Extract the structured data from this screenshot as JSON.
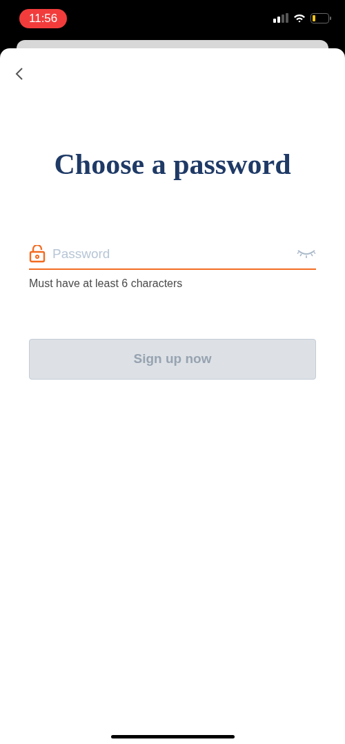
{
  "status_bar": {
    "time": "11:56"
  },
  "title": "Choose a password",
  "password_field": {
    "placeholder": "Password",
    "focused": true,
    "hint": "Must have at least 6 characters"
  },
  "button": {
    "label": "Sign up now",
    "disabled": true
  }
}
